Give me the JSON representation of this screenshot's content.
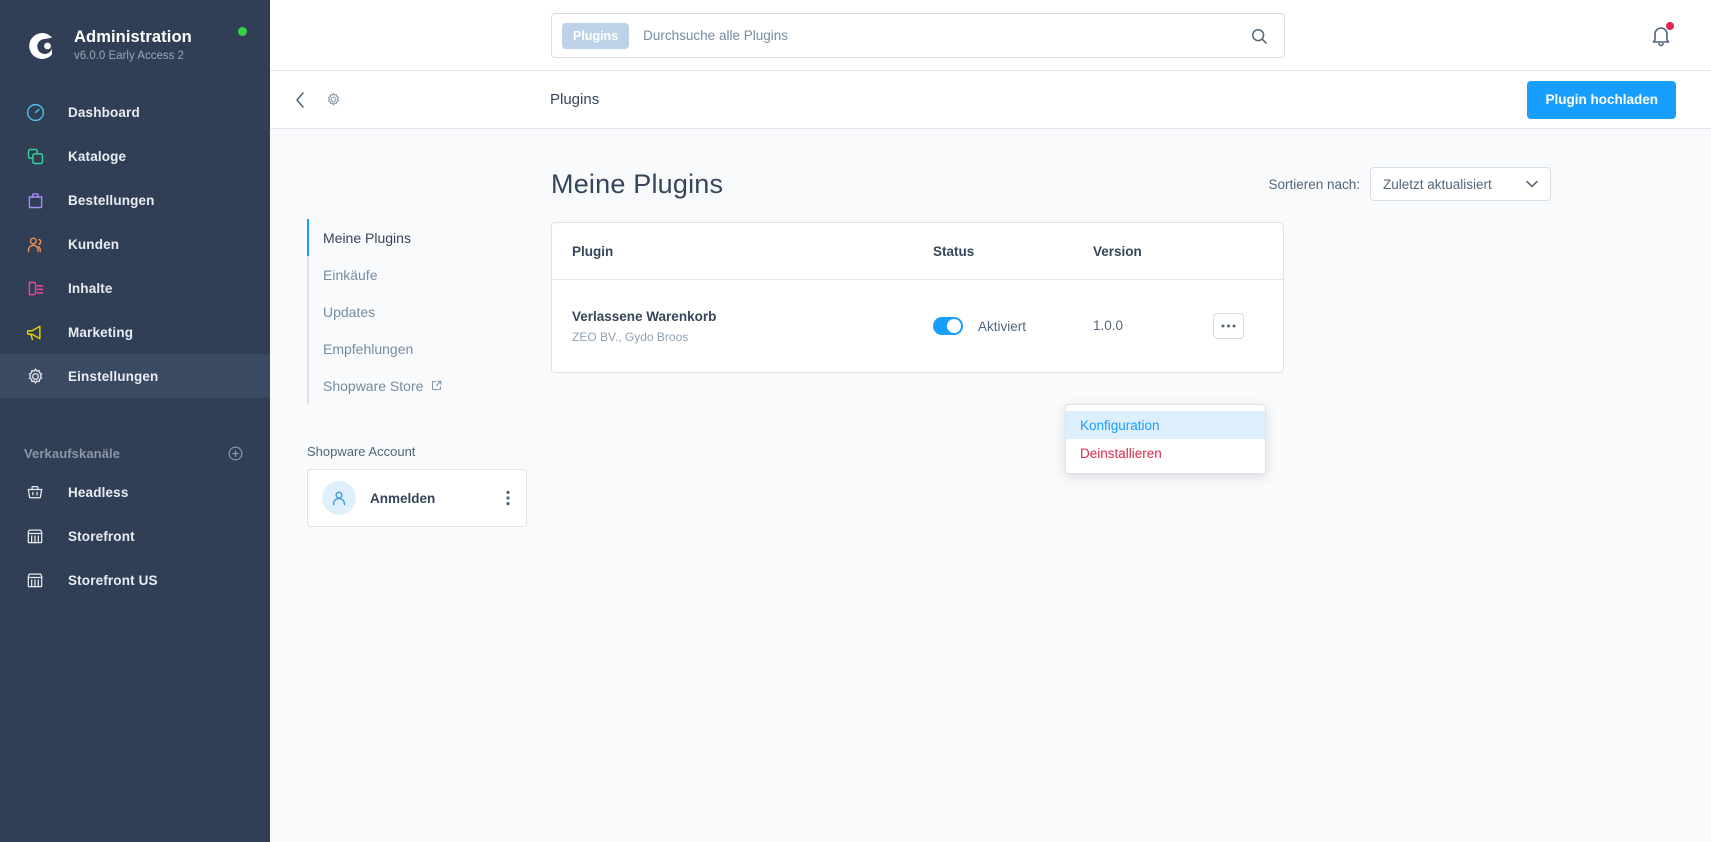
{
  "brand": {
    "logo_icon": "shopware-logo-icon",
    "title": "Administration",
    "version": "v6.0.0 Early Access 2",
    "status_dot_color": "#37d046"
  },
  "sidebar": {
    "items": [
      {
        "label": "Dashboard",
        "icon": "speedometer-icon",
        "color": "#4dc0e8",
        "active": false
      },
      {
        "label": "Kataloge",
        "icon": "copy-icon",
        "color": "#34d399",
        "active": false
      },
      {
        "label": "Bestellungen",
        "icon": "bag-icon",
        "color": "#a78bfa",
        "active": false
      },
      {
        "label": "Kunden",
        "icon": "users-icon",
        "color": "#f08b50",
        "active": false
      },
      {
        "label": "Inhalte",
        "icon": "content-icon",
        "color": "#ec4899",
        "active": false
      },
      {
        "label": "Marketing",
        "icon": "megaphone-icon",
        "color": "#f0d000",
        "active": false
      },
      {
        "label": "Einstellungen",
        "icon": "gear-icon",
        "color": "#d9dee6",
        "active": true
      }
    ],
    "channels": {
      "title": "Verkaufskanäle",
      "add_icon": "plus-circle-icon",
      "items": [
        {
          "label": "Headless",
          "icon": "basket-icon"
        },
        {
          "label": "Storefront",
          "icon": "store-icon"
        },
        {
          "label": "Storefront US",
          "icon": "store-icon"
        }
      ]
    }
  },
  "topbar": {
    "search": {
      "badge": "Plugins",
      "value": "",
      "placeholder": "Durchsuche alle Plugins",
      "icon": "search-icon"
    },
    "notifications": {
      "icon": "bell-icon",
      "has_unread": true,
      "dot_color": "#de294c"
    }
  },
  "smartbar": {
    "back_icon": "chevron-left-icon",
    "settings_icon": "gear-icon",
    "title": "Plugins",
    "action_label": "Plugin hochladen",
    "action_color": "#189eff"
  },
  "page": {
    "title": "Meine Plugins",
    "sort": {
      "label": "Sortieren nach:",
      "value": "Zuletzt aktualisiert",
      "chevron_icon": "chevron-down-icon"
    }
  },
  "side_nav": {
    "items": [
      {
        "label": "Meine Plugins",
        "active": true,
        "external": false
      },
      {
        "label": "Einkäufe",
        "active": false,
        "external": false
      },
      {
        "label": "Updates",
        "active": false,
        "external": false
      },
      {
        "label": "Empfehlungen",
        "active": false,
        "external": false
      },
      {
        "label": "Shopware Store",
        "active": false,
        "external": true,
        "external_icon": "external-link-icon"
      }
    ]
  },
  "account": {
    "section_label": "Shopware Account",
    "avatar_icon": "user-icon",
    "name": "Anmelden",
    "menu_icon": "kebab-menu-icon"
  },
  "plugins_table": {
    "columns": {
      "plugin": "Plugin",
      "status": "Status",
      "version": "Version"
    },
    "rows": [
      {
        "name": "Verlassene Warenkorb",
        "author": "ZEO BV., Gydo Broos",
        "status_enabled": true,
        "status_label": "Aktiviert",
        "version": "1.0.0",
        "actions_icon": "ellipsis-icon"
      }
    ]
  },
  "context_menu": {
    "items": [
      {
        "label": "Konfiguration",
        "style": "highlight"
      },
      {
        "label": "Deinstallieren",
        "style": "danger"
      }
    ]
  }
}
